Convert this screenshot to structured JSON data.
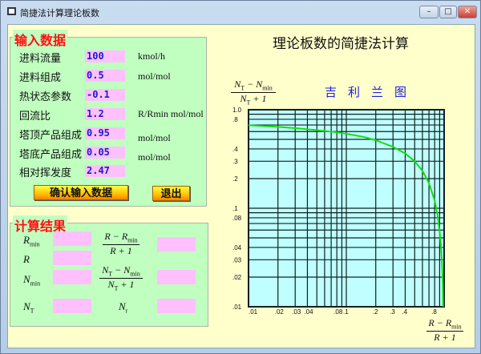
{
  "window": {
    "title": "简捷法计算理论板数",
    "buttons": {
      "minimize": "–",
      "maximize": "□",
      "close": "✕"
    }
  },
  "input_group": {
    "legend": "输入数据",
    "rows": [
      {
        "label": "进料流量",
        "value": "100",
        "unit": "kmol/h"
      },
      {
        "label": "进料组成",
        "value": "0.5",
        "unit": "mol/mol"
      },
      {
        "label": "热状态参数",
        "value": "-0.1",
        "unit": ""
      },
      {
        "label": "回流比",
        "value": "1.2",
        "unit": "R/Rmin mol/mol"
      },
      {
        "label": "塔顶产品组成",
        "value": "0.95",
        "unit": "mol/mol"
      },
      {
        "label": "塔底产品组成",
        "value": "0.05",
        "unit": "mol/mol"
      },
      {
        "label": "相对挥发度",
        "value": "2.47",
        "unit": ""
      }
    ],
    "confirm_label": "确认输入数据",
    "exit_label": "退出"
  },
  "result_group": {
    "legend": "计算结果",
    "labels": {
      "rmin": "R",
      "rmin_sub": "min",
      "r": "R",
      "nmin": "N",
      "nmin_sub": "min",
      "nt": "N",
      "nt_sub": "T",
      "nr": "N",
      "nr_sub": "r",
      "x_num": "R − R",
      "x_num_sub": "min",
      "x_den": "R + 1",
      "y_num_a": "N",
      "y_num_a_sub": "T",
      "y_num_b": " − N",
      "y_num_b_sub": "min",
      "y_den": "N",
      "y_den_sub": "T",
      "y_den_b": " + 1"
    },
    "values": {
      "rmin": "",
      "r": "",
      "nmin": "",
      "nt": "",
      "x": "",
      "y": "",
      "nr": ""
    }
  },
  "chart_title": "理论板数的简捷法计算",
  "chart_data": {
    "type": "line",
    "title": "吉利兰图",
    "xlabel": "(R − Rmin)/(R + 1)",
    "ylabel": "(NT − Nmin)/(NT + 1)",
    "xscale": "log",
    "yscale": "log",
    "xlim": [
      0.01,
      1.0
    ],
    "ylim": [
      0.01,
      1.0
    ],
    "grid": true,
    "xticks": [
      ".01",
      ".02",
      ".03",
      ".04",
      ".08",
      ".1",
      ".2",
      ".3",
      ".4",
      ".8"
    ],
    "xtick_values": [
      0.01,
      0.02,
      0.03,
      0.04,
      0.08,
      0.1,
      0.2,
      0.3,
      0.4,
      0.8
    ],
    "yticks": [
      "1.0",
      ".8",
      ".4",
      ".3",
      ".2",
      ".1",
      ".08",
      ".04",
      ".03",
      ".02",
      ".01"
    ],
    "ytick_values": [
      1.0,
      0.8,
      0.4,
      0.3,
      0.2,
      0.1,
      0.08,
      0.04,
      0.03,
      0.02,
      0.01
    ],
    "series": [
      {
        "color": "#10e010",
        "x": [
          0.01,
          0.02,
          0.03,
          0.05,
          0.08,
          0.1,
          0.15,
          0.2,
          0.3,
          0.4,
          0.5,
          0.6,
          0.7,
          0.8,
          0.85,
          0.9,
          0.93,
          0.95,
          0.97,
          0.977
        ],
        "y": [
          0.695,
          0.67,
          0.65,
          0.62,
          0.59,
          0.57,
          0.53,
          0.49,
          0.42,
          0.36,
          0.3,
          0.24,
          0.18,
          0.12,
          0.089,
          0.058,
          0.04,
          0.028,
          0.0167,
          0.01
        ]
      }
    ],
    "colors": {
      "plot_bg": "#c0ffff",
      "grid": "#102020",
      "curve": "#10e010"
    }
  }
}
